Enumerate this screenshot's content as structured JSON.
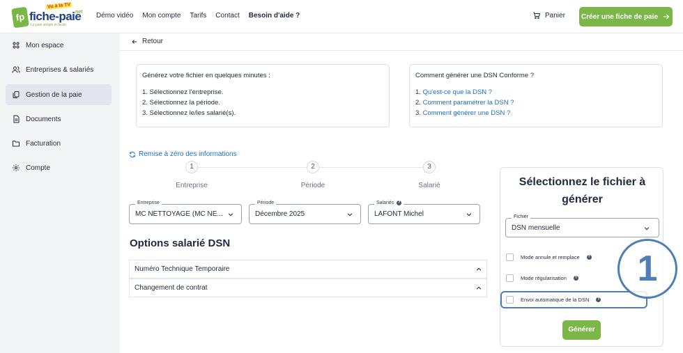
{
  "brand": {
    "badge": "fp",
    "name": "fiche-paie",
    "tv": "Vu à la TV",
    "net": ".net",
    "tagline": "La paie simple et facile"
  },
  "nav": [
    "Démo vidéo",
    "Mon compte",
    "Tarifs",
    "Contact"
  ],
  "nav_help": "Besoin d'aide ?",
  "cart_label": "Panier",
  "cta_label": "Créer une fiche de paie",
  "sidebar": [
    {
      "label": "Mon espace",
      "icon": "grid-icon"
    },
    {
      "label": "Entreprises & salariés",
      "icon": "users-icon"
    },
    {
      "label": "Gestion de la paie",
      "icon": "copy-icon"
    },
    {
      "label": "Documents",
      "icon": "document-icon"
    },
    {
      "label": "Facturation",
      "icon": "folder-icon"
    },
    {
      "label": "Compte",
      "icon": "gear-icon"
    }
  ],
  "back_label": "Retour",
  "instructions": {
    "head": "Générez votre fichier en quelques minutes :",
    "steps": [
      "1. Sélectionnez l'entreprise.",
      "2. Sélectionnez la période.",
      "3. Sélectionnez le/les salarié(s)."
    ]
  },
  "howto": {
    "head": "Comment générer une DSN Conforme ?",
    "links": [
      {
        "num": "1. ",
        "text": "Qu'est-ce que la DSN ?"
      },
      {
        "num": "2. ",
        "text": "Comment paramétrer la DSN ?"
      },
      {
        "num": "3. ",
        "text": "Comment générer une DSN ?"
      }
    ]
  },
  "reset_label": "Remise à zéro des informations",
  "steps": [
    {
      "num": "1",
      "label": "Entreprise"
    },
    {
      "num": "2",
      "label": "Période"
    },
    {
      "num": "3",
      "label": "Salarié"
    }
  ],
  "selects": {
    "entreprise": {
      "label": "Entreprise",
      "value": "MC NETTOYAGE (MC NE..."
    },
    "periode": {
      "label": "Période",
      "value": "Décembre 2025"
    },
    "salaries": {
      "label": "Salariés",
      "value": "LAFONT Michel"
    }
  },
  "options_title": "Options salarié DSN",
  "accordions": [
    "Numéro Technique Temporaire",
    "Changement de contrat"
  ],
  "panel": {
    "title": "Sélectionnez le fichier à générer",
    "file_label": "Fichier",
    "file_value": "DSN mensuelle",
    "checks": [
      "Mode annule et remplace",
      "Mode régularisation",
      "Envoi automatique de la DSN"
    ],
    "generate_label": "Générer"
  },
  "callout_number": "1",
  "colors": {
    "accent_green": "#7ab648",
    "link_blue": "#1d6ec7",
    "highlight_blue": "#4f7eb6"
  }
}
